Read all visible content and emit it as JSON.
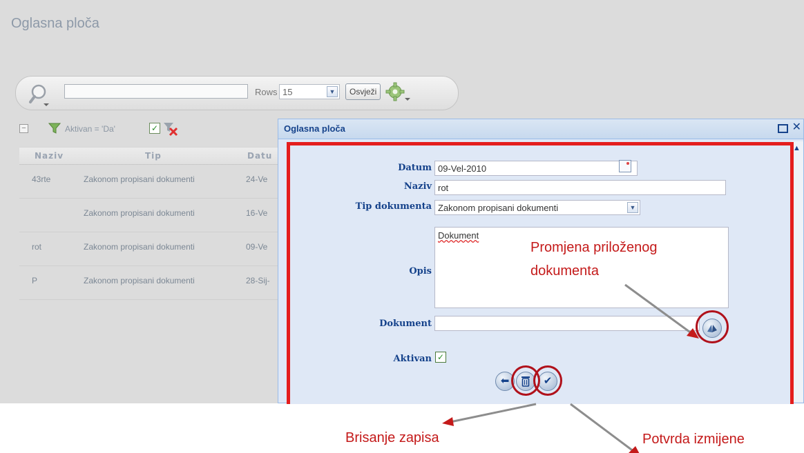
{
  "page": {
    "title": "Oglasna ploča"
  },
  "toolbar": {
    "search_value": "",
    "rows_label": "Rows",
    "rows_value": "15",
    "refresh_label": "Osvježi"
  },
  "filter": {
    "text": "Aktivan = 'Da'",
    "checked": true
  },
  "grid": {
    "headers": [
      "Naziv",
      "Tip",
      "Datu"
    ],
    "rows": [
      {
        "naziv": "43rte",
        "tip": "Zakonom propisani dokumenti",
        "datum": "24-Ve"
      },
      {
        "naziv": "",
        "tip": "Zakonom propisani dokumenti",
        "datum": "16-Ve"
      },
      {
        "naziv": "rot",
        "tip": "Zakonom propisani dokumenti",
        "datum": "09-Ve"
      },
      {
        "naziv": "P",
        "tip": "Zakonom propisani dokumenti",
        "datum": "28-Sij-"
      }
    ]
  },
  "dialog": {
    "title": "Oglasna ploča",
    "form": {
      "datum_label": "Datum",
      "datum_value": "09-Vel-2010",
      "naziv_label": "Naziv",
      "naziv_value": "rot",
      "tip_label": "Tip dokumenta",
      "tip_value": "Zakonom propisani dokumenti",
      "opis_label": "Opis",
      "opis_value": "Dokument",
      "dokument_label": "Dokument",
      "dokument_value": "",
      "aktivan_label": "Aktivan",
      "aktivan_checked": true
    }
  },
  "annotations": {
    "change_doc": [
      "Promjena priloženog",
      "dokumenta"
    ],
    "delete": "Brisanje zapisa",
    "confirm": "Potvrda izmijene"
  },
  "colors": {
    "highlight": "#e41d1d",
    "annotation": "#c41a1a",
    "dialog_title": "#15428b"
  }
}
